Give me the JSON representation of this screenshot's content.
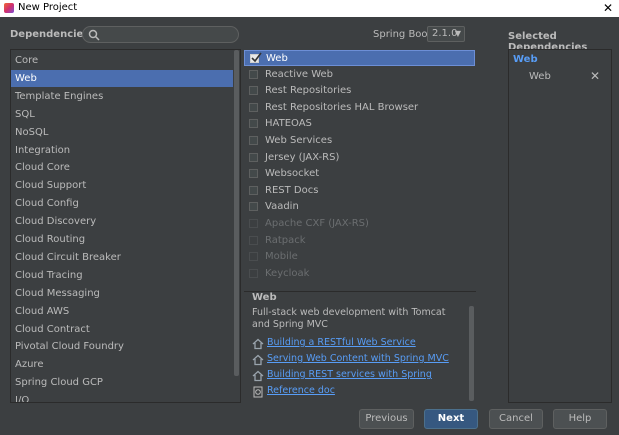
{
  "window": {
    "title": "New Project",
    "close": "✕"
  },
  "header": {
    "dependencies_label": "Dependencies",
    "spring_boot_label": "Spring Boot",
    "spring_boot_version": "2.1.0",
    "selected_label": "Selected Dependencies"
  },
  "categories": [
    {
      "label": "Core",
      "selected": false
    },
    {
      "label": "Web",
      "selected": true
    },
    {
      "label": "Template Engines",
      "selected": false
    },
    {
      "label": "SQL",
      "selected": false
    },
    {
      "label": "NoSQL",
      "selected": false
    },
    {
      "label": "Integration",
      "selected": false
    },
    {
      "label": "Cloud Core",
      "selected": false
    },
    {
      "label": "Cloud Support",
      "selected": false
    },
    {
      "label": "Cloud Config",
      "selected": false
    },
    {
      "label": "Cloud Discovery",
      "selected": false
    },
    {
      "label": "Cloud Routing",
      "selected": false
    },
    {
      "label": "Cloud Circuit Breaker",
      "selected": false
    },
    {
      "label": "Cloud Tracing",
      "selected": false
    },
    {
      "label": "Cloud Messaging",
      "selected": false
    },
    {
      "label": "Cloud AWS",
      "selected": false
    },
    {
      "label": "Cloud Contract",
      "selected": false
    },
    {
      "label": "Pivotal Cloud Foundry",
      "selected": false
    },
    {
      "label": "Azure",
      "selected": false
    },
    {
      "label": "Spring Cloud GCP",
      "selected": false
    },
    {
      "label": "I/O",
      "selected": false
    }
  ],
  "dependencies": [
    {
      "label": "Web",
      "checked": true,
      "enabled": true,
      "selected": true
    },
    {
      "label": "Reactive Web",
      "checked": false,
      "enabled": true,
      "selected": false
    },
    {
      "label": "Rest Repositories",
      "checked": false,
      "enabled": true,
      "selected": false
    },
    {
      "label": "Rest Repositories HAL Browser",
      "checked": false,
      "enabled": true,
      "selected": false
    },
    {
      "label": "HATEOAS",
      "checked": false,
      "enabled": true,
      "selected": false
    },
    {
      "label": "Web Services",
      "checked": false,
      "enabled": true,
      "selected": false
    },
    {
      "label": "Jersey (JAX-RS)",
      "checked": false,
      "enabled": true,
      "selected": false
    },
    {
      "label": "Websocket",
      "checked": false,
      "enabled": true,
      "selected": false
    },
    {
      "label": "REST Docs",
      "checked": false,
      "enabled": true,
      "selected": false
    },
    {
      "label": "Vaadin",
      "checked": false,
      "enabled": true,
      "selected": false
    },
    {
      "label": "Apache CXF (JAX-RS)",
      "checked": false,
      "enabled": false,
      "selected": false
    },
    {
      "label": "Ratpack",
      "checked": false,
      "enabled": false,
      "selected": false
    },
    {
      "label": "Mobile",
      "checked": false,
      "enabled": false,
      "selected": false
    },
    {
      "label": "Keycloak",
      "checked": false,
      "enabled": false,
      "selected": false
    }
  ],
  "description": {
    "title": "Web",
    "text": "Full-stack web development with Tomcat and Spring MVC",
    "links": [
      {
        "label": "Building a RESTful Web Service",
        "icon": "home-icon"
      },
      {
        "label": "Serving Web Content with Spring MVC",
        "icon": "home-icon"
      },
      {
        "label": "Building REST services with Spring",
        "icon": "home-icon"
      },
      {
        "label": "Reference doc",
        "icon": "doc-icon"
      }
    ]
  },
  "selected": {
    "group": "Web",
    "items": [
      {
        "label": "Web",
        "remove": "✕"
      }
    ]
  },
  "buttons": {
    "previous": "Previous",
    "next": "Next",
    "cancel": "Cancel",
    "help": "Help"
  },
  "colors": {
    "background": "#3c3f41",
    "selection": "#4b6eaf",
    "link": "#589df6",
    "primary_button": "#365880"
  }
}
